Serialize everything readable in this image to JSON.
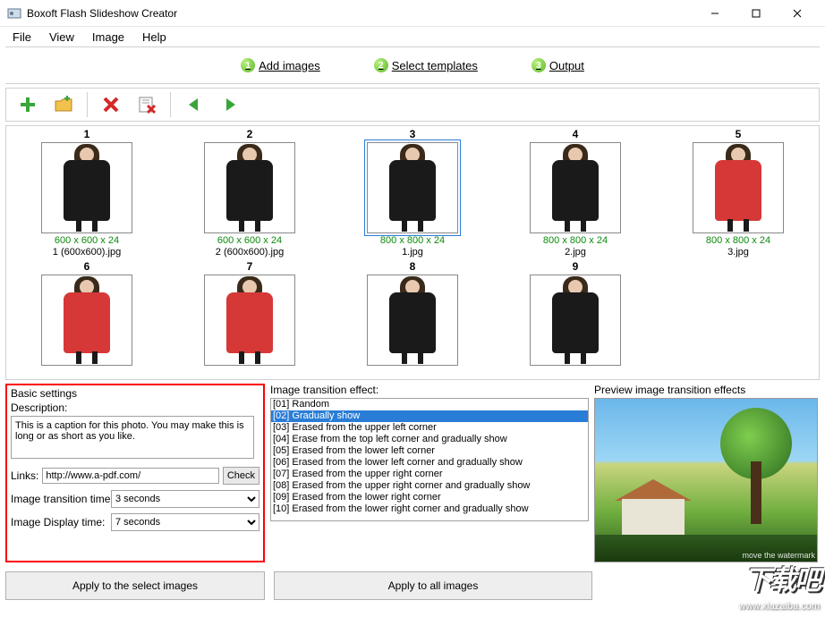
{
  "window": {
    "title": "Boxoft Flash Slideshow Creator"
  },
  "menu": {
    "file": "File",
    "view": "View",
    "image": "Image",
    "help": "Help"
  },
  "steps": {
    "s1": "Add images",
    "s2": "Select templates",
    "s3": "Output"
  },
  "thumbs": [
    {
      "num": "1",
      "dim": "600 x 600 x 24",
      "name": "1 (600x600).jpg",
      "variant": "black"
    },
    {
      "num": "2",
      "dim": "600 x 600 x 24",
      "name": "2 (600x600).jpg",
      "variant": "black"
    },
    {
      "num": "3",
      "dim": "800 x 800 x 24",
      "name": "1.jpg",
      "variant": "black",
      "selected": true
    },
    {
      "num": "4",
      "dim": "800 x 800 x 24",
      "name": "2.jpg",
      "variant": "black"
    },
    {
      "num": "5",
      "dim": "800 x 800 x 24",
      "name": "3.jpg",
      "variant": "red"
    },
    {
      "num": "6",
      "dim": "",
      "name": "",
      "variant": "red"
    },
    {
      "num": "7",
      "dim": "",
      "name": "",
      "variant": "red"
    },
    {
      "num": "8",
      "dim": "",
      "name": "",
      "variant": "black"
    },
    {
      "num": "9",
      "dim": "",
      "name": "",
      "variant": "black"
    }
  ],
  "basic": {
    "panel_title": "Basic settings",
    "desc_label": "Description:",
    "desc_value": "This is a caption for this photo. You may make this is long or as short as you like.",
    "links_label": "Links:",
    "links_value": "http://www.a-pdf.com/",
    "check_label": "Check",
    "trans_label": "Image transition time:",
    "trans_value": "3 seconds",
    "disp_label": "Image Display time:",
    "disp_value": "7 seconds"
  },
  "fx": {
    "title": "Image transition effect:",
    "items": [
      "[01] Random",
      "[02] Gradually show",
      "[03] Erased from the upper left corner",
      "[04] Erase from the top left corner and gradually show",
      "[05] Erased from the lower left corner",
      "[06] Erased from the lower left corner and gradually show",
      "[07] Erased from the upper right corner",
      "[08] Erased from the upper right corner and gradually show",
      "[09] Erased from the lower right corner",
      "[10] Erased from the lower right corner and gradually show"
    ],
    "selected_index": 1
  },
  "preview": {
    "title": "Preview image transition effects",
    "wm": "move the watermark"
  },
  "apply": {
    "sel": "Apply to the select images",
    "all": "Apply to all images"
  },
  "overlay": {
    "big": "下载吧",
    "url": "www.xiazaiba.com"
  }
}
